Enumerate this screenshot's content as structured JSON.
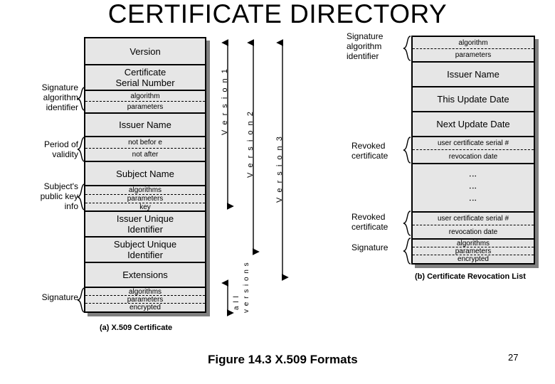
{
  "title": "CERTIFICATE DIRECTORY",
  "certificate": {
    "caption": "(a) X.509 Certificate",
    "rows": [
      {
        "name": "version",
        "label": "Version",
        "style": "big"
      },
      {
        "name": "serial-number",
        "label": "Certificate\nSerial Number",
        "style": "big"
      },
      {
        "name": "signature-algorithm",
        "style": "small",
        "subs": [
          "algorithm",
          "parameters"
        ]
      },
      {
        "name": "issuer-name",
        "label": "Issuer  Name",
        "style": "big"
      },
      {
        "name": "validity",
        "style": "small",
        "subs": [
          "not befor e",
          "not after"
        ]
      },
      {
        "name": "subject-name",
        "label": "Subject Name",
        "style": "big"
      },
      {
        "name": "subject-public-key",
        "style": "small",
        "subs": [
          "algorithms",
          "parameters",
          "key"
        ]
      },
      {
        "name": "issuer-unique-id",
        "label": "Issuer  Unique\nIdentifier",
        "style": "big"
      },
      {
        "name": "subject-unique-id",
        "label": "Subject Unique\nIdentifier",
        "style": "big"
      },
      {
        "name": "extensions",
        "label": "Extensions",
        "style": "big"
      },
      {
        "name": "signature",
        "style": "small",
        "subs": [
          "algorithms",
          "parameters",
          "encrypted"
        ]
      }
    ],
    "side_labels": [
      {
        "name": "signature-algorithm-identifier",
        "text": "Signature\nalgorithm\nidentifier"
      },
      {
        "name": "period-of-validity",
        "text": "Period of\nvalidity"
      },
      {
        "name": "subjects-public-key-info",
        "text": "Subject's\npublic key\ninfo"
      },
      {
        "name": "signature",
        "text": "Signature"
      }
    ]
  },
  "crl": {
    "caption": "(b) Certificate Revocation List",
    "rows": [
      {
        "name": "signature-algorithm",
        "style": "small",
        "subs": [
          "algorithm",
          "parameters"
        ]
      },
      {
        "name": "issuer-name",
        "label": "Issuer  Name",
        "style": "big"
      },
      {
        "name": "this-update-date",
        "label": "This Update Date",
        "style": "big"
      },
      {
        "name": "next-update-date",
        "label": "Next Update Date",
        "style": "big"
      },
      {
        "name": "revoked-certificate-1",
        "style": "small",
        "subs": [
          "user certificate serial #",
          "revocation date"
        ]
      },
      {
        "name": "ellipsis",
        "style": "dots"
      },
      {
        "name": "revoked-certificate-n",
        "style": "small",
        "subs": [
          "user certificate serial #",
          "revocation date"
        ]
      },
      {
        "name": "signature",
        "style": "small",
        "subs": [
          "algorithms",
          "parameters",
          "encrypted"
        ]
      }
    ],
    "side_labels": [
      {
        "name": "signature-algorithm-identifier",
        "text": "Signature\nalgorithm\nidentifier"
      },
      {
        "name": "revoked-certificate-1",
        "text": "Revoked\ncertificate"
      },
      {
        "name": "revoked-certificate-n",
        "text": "Revoked\ncertificate"
      },
      {
        "name": "signature",
        "text": "Signature"
      }
    ]
  },
  "versions": [
    {
      "name": "version-1",
      "label": "V e r s i o n  1"
    },
    {
      "name": "version-2",
      "label": "V e r s i o n  2"
    },
    {
      "name": "version-3",
      "label": "V e r s i o n  3"
    }
  ],
  "all_versions": {
    "line1": "a l l",
    "line2": "v e r s i o n s"
  },
  "figure_caption": "Figure 14.3   X.509 Formats",
  "page_number": "27",
  "colors": {
    "box_fill": "#e6e6e6",
    "box_border": "#000000",
    "shadow": "#808080",
    "background": "#ffffff",
    "text": "#000000"
  }
}
